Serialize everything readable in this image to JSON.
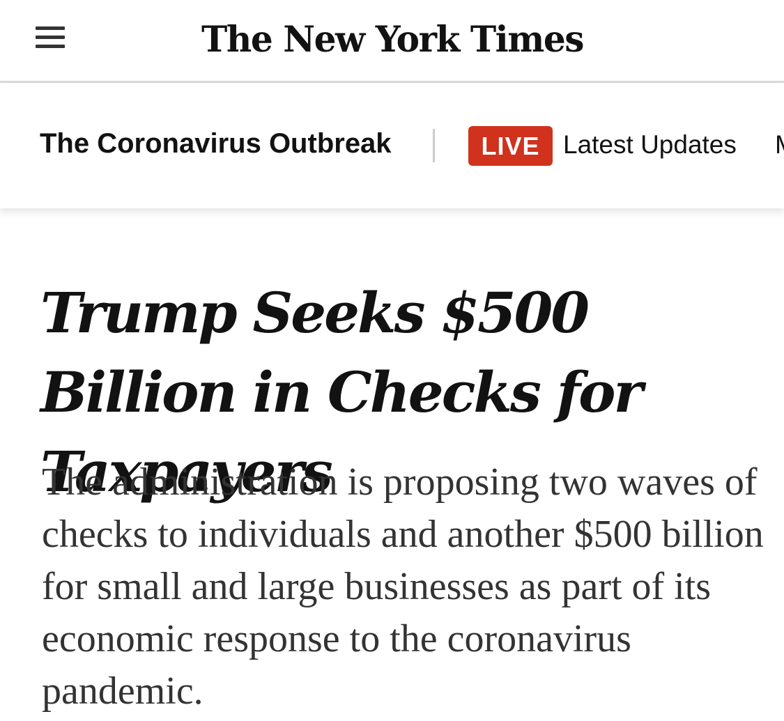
{
  "masthead": {
    "menu_icon": "hamburger-menu-icon",
    "logo_text": "The New York Times"
  },
  "section_bar": {
    "title": "The Coronavirus Outbreak",
    "live_badge": "LIVE",
    "live_badge_color": "#d0321d",
    "latest_link": "Latest Updates",
    "next_link_partial": "M"
  },
  "article": {
    "headline": "Trump Seeks $500 Billion in Checks for Taxpayers",
    "summary": "The administration is proposing two waves of checks to individuals and another $500 billion for small and large businesses as part of its economic response to the coronavirus pandemic."
  }
}
